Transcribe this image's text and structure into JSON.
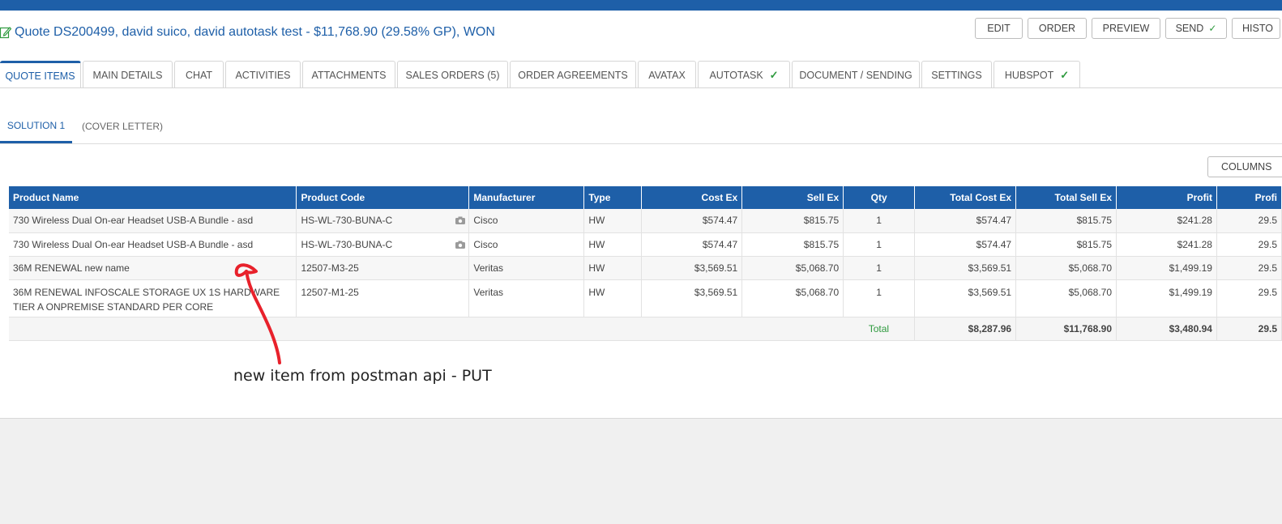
{
  "header": {
    "title": "Quote DS200499,  david suico,  david autotask test - $11,768.90 (29.58% GP), WON",
    "actions": [
      {
        "label": "EDIT"
      },
      {
        "label": "ORDER"
      },
      {
        "label": "PREVIEW"
      },
      {
        "label": "SEND"
      },
      {
        "label": "HISTO"
      }
    ]
  },
  "tabs": [
    {
      "label": "QUOTE ITEMS",
      "active": true
    },
    {
      "label": "MAIN DETAILS"
    },
    {
      "label": "CHAT"
    },
    {
      "label": "ACTIVITIES"
    },
    {
      "label": "ATTACHMENTS"
    },
    {
      "label": "SALES ORDERS (5)"
    },
    {
      "label": "ORDER AGREEMENTS"
    },
    {
      "label": "AVATAX"
    },
    {
      "label": "AUTOTASK",
      "check": true
    },
    {
      "label": "DOCUMENT / SENDING"
    },
    {
      "label": "SETTINGS"
    },
    {
      "label": "HUBSPOT",
      "check": true
    }
  ],
  "subtabs": [
    {
      "label": "SOLUTION 1",
      "active": true
    },
    {
      "label": "(COVER LETTER)"
    }
  ],
  "columns_button": "COLUMNS",
  "table": {
    "headers": [
      "Product Name",
      "Product Code",
      "Manufacturer",
      "Type",
      "Cost Ex",
      "Sell Ex",
      "Qty",
      "Total Cost Ex",
      "Total Sell Ex",
      "Profit",
      "Profi"
    ],
    "rows": [
      [
        "730 Wireless Dual On-ear Headset USB-A Bundle - asd",
        "HS-WL-730-BUNA-C",
        "Cisco",
        "HW",
        "$574.47",
        "$815.75",
        "1",
        "$574.47",
        "$815.75",
        "$241.28",
        "29.5"
      ],
      [
        "730 Wireless Dual On-ear Headset USB-A Bundle - asd",
        "HS-WL-730-BUNA-C",
        "Cisco",
        "HW",
        "$574.47",
        "$815.75",
        "1",
        "$574.47",
        "$815.75",
        "$241.28",
        "29.5"
      ],
      [
        "36M RENEWAL new name",
        "12507-M3-25",
        "Veritas",
        "HW",
        "$3,569.51",
        "$5,068.70",
        "1",
        "$3,569.51",
        "$5,068.70",
        "$1,499.19",
        "29.5"
      ],
      [
        "36M RENEWAL INFOSCALE STORAGE UX 1S HARDWARE TIER A ONPREMISE STANDARD PER CORE",
        "12507-M1-25",
        "Veritas",
        "HW",
        "$3,569.51",
        "$5,068.70",
        "1",
        "$3,569.51",
        "$5,068.70",
        "$1,499.19",
        "29.5"
      ]
    ],
    "total": {
      "label": "Total",
      "total_cost": "$8,287.96",
      "total_sell": "$11,768.90",
      "profit": "$3,480.94",
      "profit_pct": "29.5"
    }
  },
  "annotation": {
    "text": "new item from postman api - PUT",
    "color": "#e8212b"
  },
  "colors": {
    "brand": "#1e5fa8",
    "success": "#2e9a3e"
  }
}
